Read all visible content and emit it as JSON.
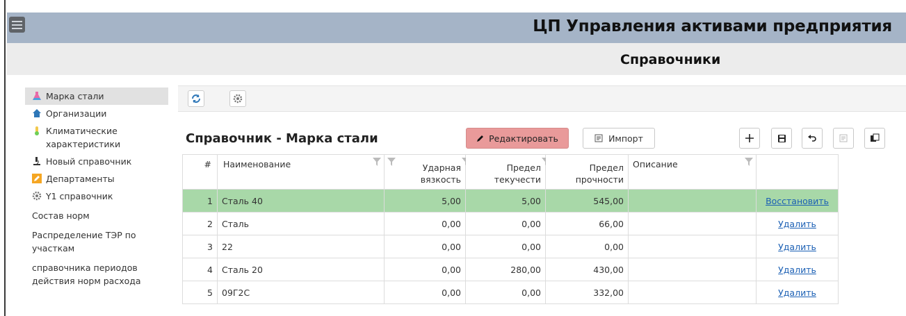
{
  "app": {
    "title": "ЦП Управления активами предприятия",
    "section_title": "Справочники"
  },
  "sidebar": {
    "items": [
      {
        "label": "Марка стали",
        "icon": "flask-icon",
        "active": true
      },
      {
        "label": "Организации",
        "icon": "home-icon"
      },
      {
        "label": "Климатические характеристики",
        "icon": "thermometer-icon"
      },
      {
        "label": "Новый справочник",
        "icon": "microscope-icon"
      },
      {
        "label": "Департаменты",
        "icon": "pencil-icon"
      },
      {
        "label": "Y1 справочник",
        "icon": "gear-icon"
      },
      {
        "label": "Состав норм"
      },
      {
        "label": "Распределение ТЭР по участкам"
      },
      {
        "label": "справочника периодов действия норм расхода"
      }
    ]
  },
  "toolbar": {
    "refresh_icon": "refresh-icon",
    "settings_icon": "settings-icon"
  },
  "dictionary": {
    "title": "Справочник - Марка стали",
    "edit_label": "Редактировать",
    "import_label": "Импорт"
  },
  "table": {
    "headers": {
      "num": "#",
      "name": "Наименование",
      "impact": "Ударная вязкость",
      "yield": "Предел текучести",
      "strength": "Предел прочности",
      "desc": "Описание"
    },
    "rows": [
      {
        "num": "1",
        "name": "Сталь 40",
        "impact": "5,00",
        "yield": "5,00",
        "strength": "545,00",
        "desc": "",
        "action": "Восстановить",
        "restored": true
      },
      {
        "num": "2",
        "name": "Сталь",
        "impact": "0,00",
        "yield": "0,00",
        "strength": "66,00",
        "desc": "",
        "action": "Удалить"
      },
      {
        "num": "3",
        "name": "22",
        "impact": "0,00",
        "yield": "0,00",
        "strength": "0,00",
        "desc": "",
        "action": "Удалить"
      },
      {
        "num": "4",
        "name": "Сталь 20",
        "impact": "0,00",
        "yield": "280,00",
        "strength": "430,00",
        "desc": "",
        "action": "Удалить"
      },
      {
        "num": "5",
        "name": "09Г2С",
        "impact": "0,00",
        "yield": "0,00",
        "strength": "332,00",
        "desc": "",
        "action": "Удалить"
      }
    ]
  },
  "colors": {
    "header_bg": "#a5b4c7",
    "subheader_bg": "#ececec",
    "edit_button": "#e99a9a",
    "restored_row": "#a8d8a8",
    "link": "#1a5fb4"
  }
}
